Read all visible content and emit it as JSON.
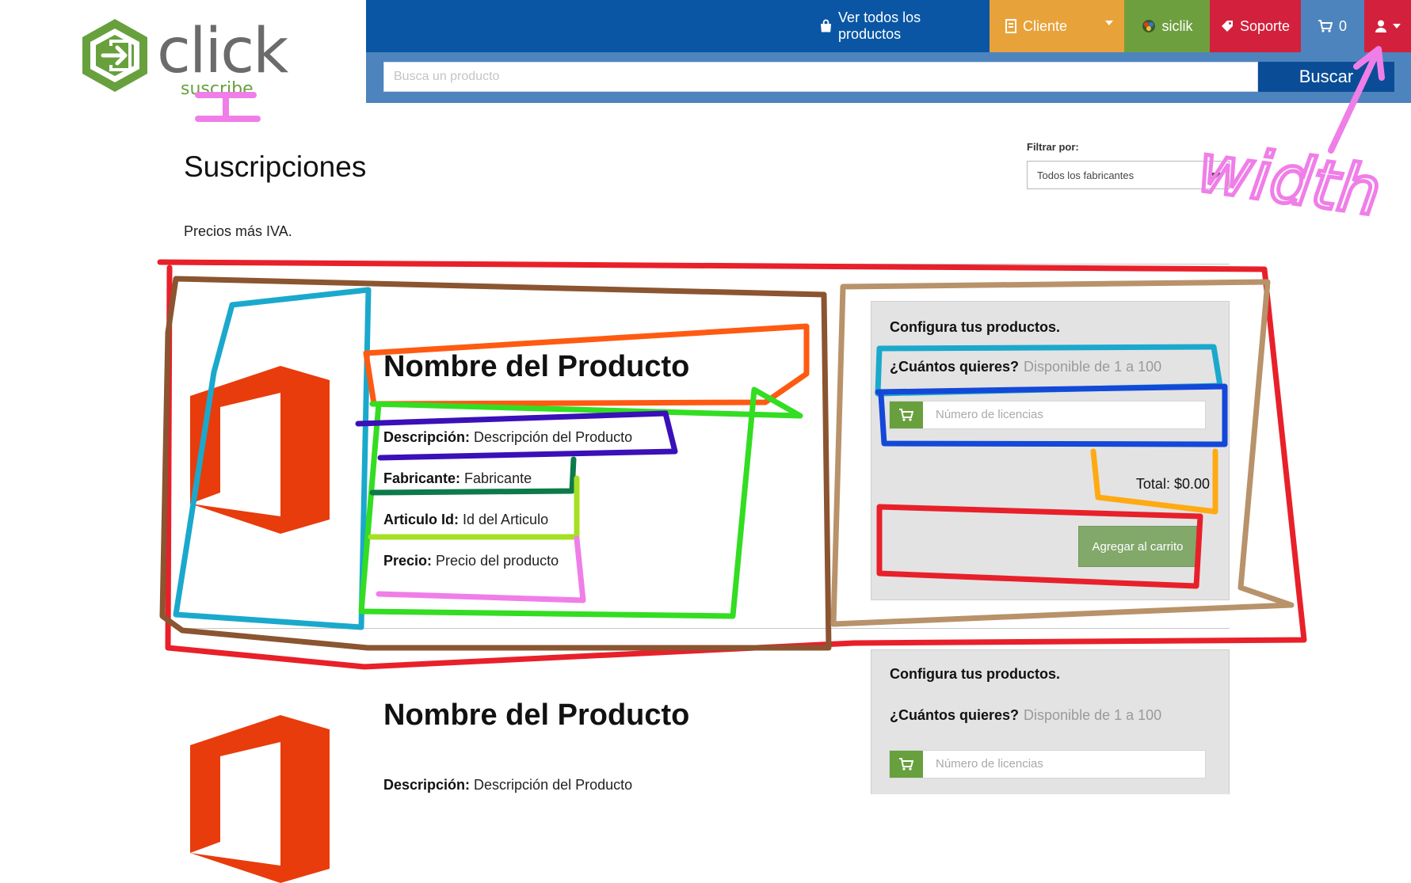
{
  "brand": {
    "name": "click",
    "tagline": "suscribe"
  },
  "nav": {
    "products": "Ver todos los productos",
    "cliente": "Cliente",
    "siclik": "siclik",
    "soporte": "Soporte",
    "cart_count": "0"
  },
  "search": {
    "placeholder": "Busca un producto",
    "button": "Buscar"
  },
  "page": {
    "title": "Suscripciones",
    "price_note": "Precios más IVA."
  },
  "filter": {
    "label": "Filtrar por:",
    "selected": "Todos los fabricantes"
  },
  "products": [
    {
      "name": "Nombre del Producto",
      "fields": [
        {
          "label": "Descripción:",
          "value": "Descripción del Producto"
        },
        {
          "label": "Fabricante:",
          "value": "Fabricante"
        },
        {
          "label": "Articulo Id:",
          "value": "Id del Articulo"
        },
        {
          "label": "Precio:",
          "value": "Precio del producto"
        }
      ],
      "config": {
        "title": "Configura tus productos.",
        "question": "¿Cuántos quieres?",
        "availability": "Disponible de 1 a 100",
        "licenses_placeholder": "Número de licencias",
        "total": "Total: $0.00",
        "add_to_cart": "Agregar al carrito"
      }
    },
    {
      "name": "Nombre del Producto",
      "fields": [
        {
          "label": "Descripción:",
          "value": "Descripción del Producto"
        }
      ],
      "config": {
        "title": "Configura tus productos.",
        "question": "¿Cuántos quieres?",
        "availability": "Disponible de 1 a 100",
        "licenses_placeholder": "Número de licencias"
      }
    }
  ],
  "annotations": {
    "note": "width",
    "marker": "I"
  },
  "colors": {
    "header_blue": "#0a56a4",
    "search_band": "#4d84bd",
    "cliente_orange": "#e8a23a",
    "siclik_green": "#6e9f3f",
    "soporte_red": "#d3203c",
    "office_orange": "#e83c0c",
    "brand_green": "#67a03c"
  }
}
